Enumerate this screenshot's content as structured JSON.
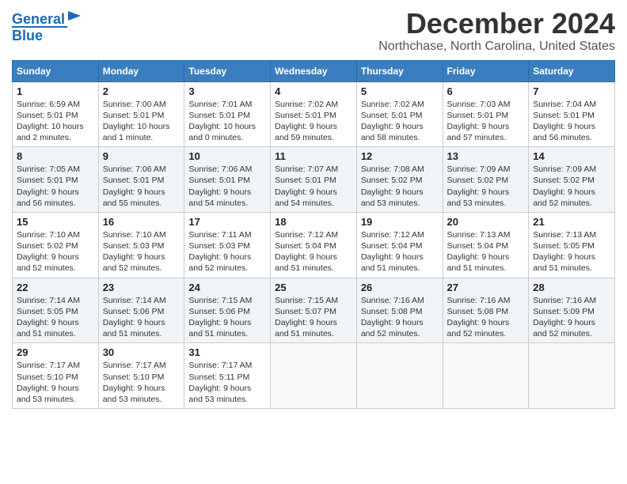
{
  "header": {
    "logo_line1": "General",
    "logo_line2": "Blue",
    "month_title": "December 2024",
    "location": "Northchase, North Carolina, United States"
  },
  "weekdays": [
    "Sunday",
    "Monday",
    "Tuesday",
    "Wednesday",
    "Thursday",
    "Friday",
    "Saturday"
  ],
  "weeks": [
    [
      {
        "day": "1",
        "sunrise": "6:59 AM",
        "sunset": "5:01 PM",
        "daylight": "10 hours and 2 minutes."
      },
      {
        "day": "2",
        "sunrise": "7:00 AM",
        "sunset": "5:01 PM",
        "daylight": "10 hours and 1 minute."
      },
      {
        "day": "3",
        "sunrise": "7:01 AM",
        "sunset": "5:01 PM",
        "daylight": "10 hours and 0 minutes."
      },
      {
        "day": "4",
        "sunrise": "7:02 AM",
        "sunset": "5:01 PM",
        "daylight": "9 hours and 59 minutes."
      },
      {
        "day": "5",
        "sunrise": "7:02 AM",
        "sunset": "5:01 PM",
        "daylight": "9 hours and 58 minutes."
      },
      {
        "day": "6",
        "sunrise": "7:03 AM",
        "sunset": "5:01 PM",
        "daylight": "9 hours and 57 minutes."
      },
      {
        "day": "7",
        "sunrise": "7:04 AM",
        "sunset": "5:01 PM",
        "daylight": "9 hours and 56 minutes."
      }
    ],
    [
      {
        "day": "8",
        "sunrise": "7:05 AM",
        "sunset": "5:01 PM",
        "daylight": "9 hours and 56 minutes."
      },
      {
        "day": "9",
        "sunrise": "7:06 AM",
        "sunset": "5:01 PM",
        "daylight": "9 hours and 55 minutes."
      },
      {
        "day": "10",
        "sunrise": "7:06 AM",
        "sunset": "5:01 PM",
        "daylight": "9 hours and 54 minutes."
      },
      {
        "day": "11",
        "sunrise": "7:07 AM",
        "sunset": "5:01 PM",
        "daylight": "9 hours and 54 minutes."
      },
      {
        "day": "12",
        "sunrise": "7:08 AM",
        "sunset": "5:02 PM",
        "daylight": "9 hours and 53 minutes."
      },
      {
        "day": "13",
        "sunrise": "7:09 AM",
        "sunset": "5:02 PM",
        "daylight": "9 hours and 53 minutes."
      },
      {
        "day": "14",
        "sunrise": "7:09 AM",
        "sunset": "5:02 PM",
        "daylight": "9 hours and 52 minutes."
      }
    ],
    [
      {
        "day": "15",
        "sunrise": "7:10 AM",
        "sunset": "5:02 PM",
        "daylight": "9 hours and 52 minutes."
      },
      {
        "day": "16",
        "sunrise": "7:10 AM",
        "sunset": "5:03 PM",
        "daylight": "9 hours and 52 minutes."
      },
      {
        "day": "17",
        "sunrise": "7:11 AM",
        "sunset": "5:03 PM",
        "daylight": "9 hours and 52 minutes."
      },
      {
        "day": "18",
        "sunrise": "7:12 AM",
        "sunset": "5:04 PM",
        "daylight": "9 hours and 51 minutes."
      },
      {
        "day": "19",
        "sunrise": "7:12 AM",
        "sunset": "5:04 PM",
        "daylight": "9 hours and 51 minutes."
      },
      {
        "day": "20",
        "sunrise": "7:13 AM",
        "sunset": "5:04 PM",
        "daylight": "9 hours and 51 minutes."
      },
      {
        "day": "21",
        "sunrise": "7:13 AM",
        "sunset": "5:05 PM",
        "daylight": "9 hours and 51 minutes."
      }
    ],
    [
      {
        "day": "22",
        "sunrise": "7:14 AM",
        "sunset": "5:05 PM",
        "daylight": "9 hours and 51 minutes."
      },
      {
        "day": "23",
        "sunrise": "7:14 AM",
        "sunset": "5:06 PM",
        "daylight": "9 hours and 51 minutes."
      },
      {
        "day": "24",
        "sunrise": "7:15 AM",
        "sunset": "5:06 PM",
        "daylight": "9 hours and 51 minutes."
      },
      {
        "day": "25",
        "sunrise": "7:15 AM",
        "sunset": "5:07 PM",
        "daylight": "9 hours and 51 minutes."
      },
      {
        "day": "26",
        "sunrise": "7:16 AM",
        "sunset": "5:08 PM",
        "daylight": "9 hours and 52 minutes."
      },
      {
        "day": "27",
        "sunrise": "7:16 AM",
        "sunset": "5:08 PM",
        "daylight": "9 hours and 52 minutes."
      },
      {
        "day": "28",
        "sunrise": "7:16 AM",
        "sunset": "5:09 PM",
        "daylight": "9 hours and 52 minutes."
      }
    ],
    [
      {
        "day": "29",
        "sunrise": "7:17 AM",
        "sunset": "5:10 PM",
        "daylight": "9 hours and 53 minutes."
      },
      {
        "day": "30",
        "sunrise": "7:17 AM",
        "sunset": "5:10 PM",
        "daylight": "9 hours and 53 minutes."
      },
      {
        "day": "31",
        "sunrise": "7:17 AM",
        "sunset": "5:11 PM",
        "daylight": "9 hours and 53 minutes."
      },
      null,
      null,
      null,
      null
    ]
  ],
  "labels": {
    "sunrise": "Sunrise:",
    "sunset": "Sunset:",
    "daylight": "Daylight:"
  }
}
